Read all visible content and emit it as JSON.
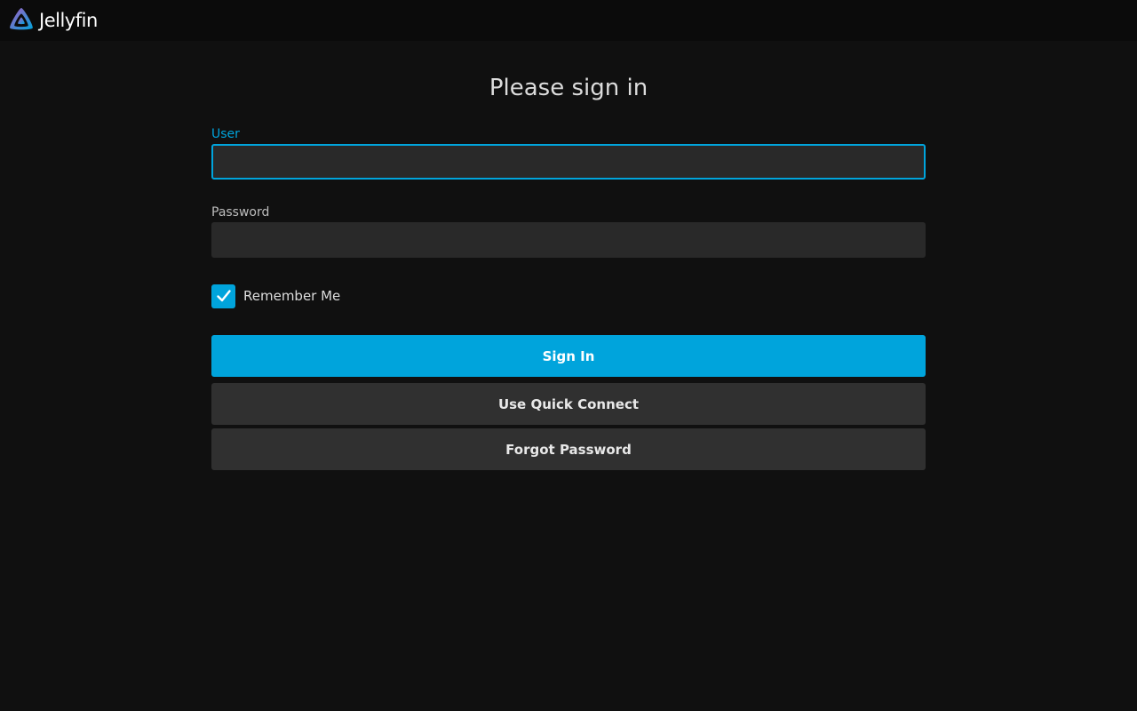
{
  "header": {
    "brand": "Jellyfin",
    "logo_icon": "jellyfin-logo-icon"
  },
  "page": {
    "title": "Please sign in"
  },
  "form": {
    "user_label": "User",
    "user_value": "",
    "password_label": "Password",
    "password_value": "",
    "remember_label": "Remember Me",
    "remember_checked": true,
    "sign_in_label": "Sign In",
    "quick_connect_label": "Use Quick Connect",
    "forgot_password_label": "Forgot Password"
  },
  "colors": {
    "accent": "#00a4dc",
    "background": "#101010",
    "input_bg": "#292929",
    "secondary_button": "#303030"
  }
}
